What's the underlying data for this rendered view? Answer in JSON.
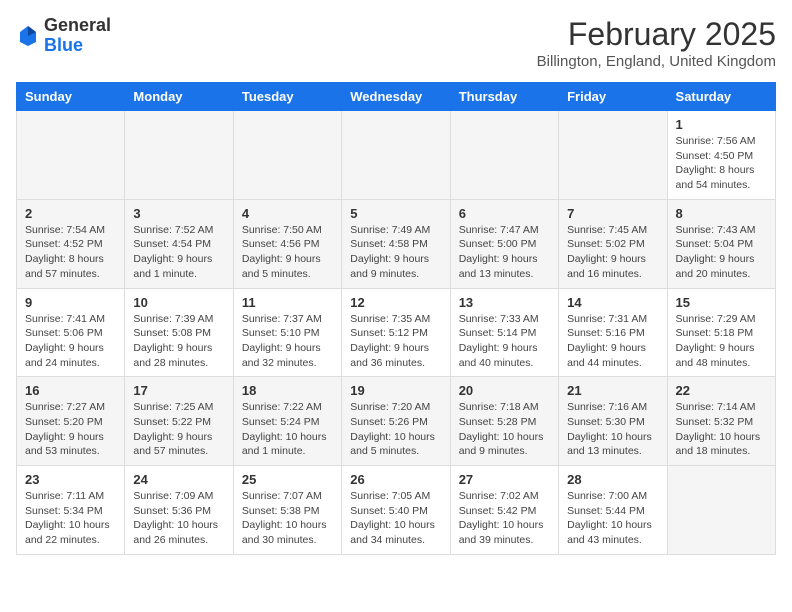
{
  "logo": {
    "general": "General",
    "blue": "Blue"
  },
  "header": {
    "month": "February 2025",
    "location": "Billington, England, United Kingdom"
  },
  "days_of_week": [
    "Sunday",
    "Monday",
    "Tuesday",
    "Wednesday",
    "Thursday",
    "Friday",
    "Saturday"
  ],
  "weeks": [
    [
      {
        "day": "",
        "info": ""
      },
      {
        "day": "",
        "info": ""
      },
      {
        "day": "",
        "info": ""
      },
      {
        "day": "",
        "info": ""
      },
      {
        "day": "",
        "info": ""
      },
      {
        "day": "",
        "info": ""
      },
      {
        "day": "1",
        "info": "Sunrise: 7:56 AM\nSunset: 4:50 PM\nDaylight: 8 hours and 54 minutes."
      }
    ],
    [
      {
        "day": "2",
        "info": "Sunrise: 7:54 AM\nSunset: 4:52 PM\nDaylight: 8 hours and 57 minutes."
      },
      {
        "day": "3",
        "info": "Sunrise: 7:52 AM\nSunset: 4:54 PM\nDaylight: 9 hours and 1 minute."
      },
      {
        "day": "4",
        "info": "Sunrise: 7:50 AM\nSunset: 4:56 PM\nDaylight: 9 hours and 5 minutes."
      },
      {
        "day": "5",
        "info": "Sunrise: 7:49 AM\nSunset: 4:58 PM\nDaylight: 9 hours and 9 minutes."
      },
      {
        "day": "6",
        "info": "Sunrise: 7:47 AM\nSunset: 5:00 PM\nDaylight: 9 hours and 13 minutes."
      },
      {
        "day": "7",
        "info": "Sunrise: 7:45 AM\nSunset: 5:02 PM\nDaylight: 9 hours and 16 minutes."
      },
      {
        "day": "8",
        "info": "Sunrise: 7:43 AM\nSunset: 5:04 PM\nDaylight: 9 hours and 20 minutes."
      }
    ],
    [
      {
        "day": "9",
        "info": "Sunrise: 7:41 AM\nSunset: 5:06 PM\nDaylight: 9 hours and 24 minutes."
      },
      {
        "day": "10",
        "info": "Sunrise: 7:39 AM\nSunset: 5:08 PM\nDaylight: 9 hours and 28 minutes."
      },
      {
        "day": "11",
        "info": "Sunrise: 7:37 AM\nSunset: 5:10 PM\nDaylight: 9 hours and 32 minutes."
      },
      {
        "day": "12",
        "info": "Sunrise: 7:35 AM\nSunset: 5:12 PM\nDaylight: 9 hours and 36 minutes."
      },
      {
        "day": "13",
        "info": "Sunrise: 7:33 AM\nSunset: 5:14 PM\nDaylight: 9 hours and 40 minutes."
      },
      {
        "day": "14",
        "info": "Sunrise: 7:31 AM\nSunset: 5:16 PM\nDaylight: 9 hours and 44 minutes."
      },
      {
        "day": "15",
        "info": "Sunrise: 7:29 AM\nSunset: 5:18 PM\nDaylight: 9 hours and 48 minutes."
      }
    ],
    [
      {
        "day": "16",
        "info": "Sunrise: 7:27 AM\nSunset: 5:20 PM\nDaylight: 9 hours and 53 minutes."
      },
      {
        "day": "17",
        "info": "Sunrise: 7:25 AM\nSunset: 5:22 PM\nDaylight: 9 hours and 57 minutes."
      },
      {
        "day": "18",
        "info": "Sunrise: 7:22 AM\nSunset: 5:24 PM\nDaylight: 10 hours and 1 minute."
      },
      {
        "day": "19",
        "info": "Sunrise: 7:20 AM\nSunset: 5:26 PM\nDaylight: 10 hours and 5 minutes."
      },
      {
        "day": "20",
        "info": "Sunrise: 7:18 AM\nSunset: 5:28 PM\nDaylight: 10 hours and 9 minutes."
      },
      {
        "day": "21",
        "info": "Sunrise: 7:16 AM\nSunset: 5:30 PM\nDaylight: 10 hours and 13 minutes."
      },
      {
        "day": "22",
        "info": "Sunrise: 7:14 AM\nSunset: 5:32 PM\nDaylight: 10 hours and 18 minutes."
      }
    ],
    [
      {
        "day": "23",
        "info": "Sunrise: 7:11 AM\nSunset: 5:34 PM\nDaylight: 10 hours and 22 minutes."
      },
      {
        "day": "24",
        "info": "Sunrise: 7:09 AM\nSunset: 5:36 PM\nDaylight: 10 hours and 26 minutes."
      },
      {
        "day": "25",
        "info": "Sunrise: 7:07 AM\nSunset: 5:38 PM\nDaylight: 10 hours and 30 minutes."
      },
      {
        "day": "26",
        "info": "Sunrise: 7:05 AM\nSunset: 5:40 PM\nDaylight: 10 hours and 34 minutes."
      },
      {
        "day": "27",
        "info": "Sunrise: 7:02 AM\nSunset: 5:42 PM\nDaylight: 10 hours and 39 minutes."
      },
      {
        "day": "28",
        "info": "Sunrise: 7:00 AM\nSunset: 5:44 PM\nDaylight: 10 hours and 43 minutes."
      },
      {
        "day": "",
        "info": ""
      }
    ]
  ]
}
